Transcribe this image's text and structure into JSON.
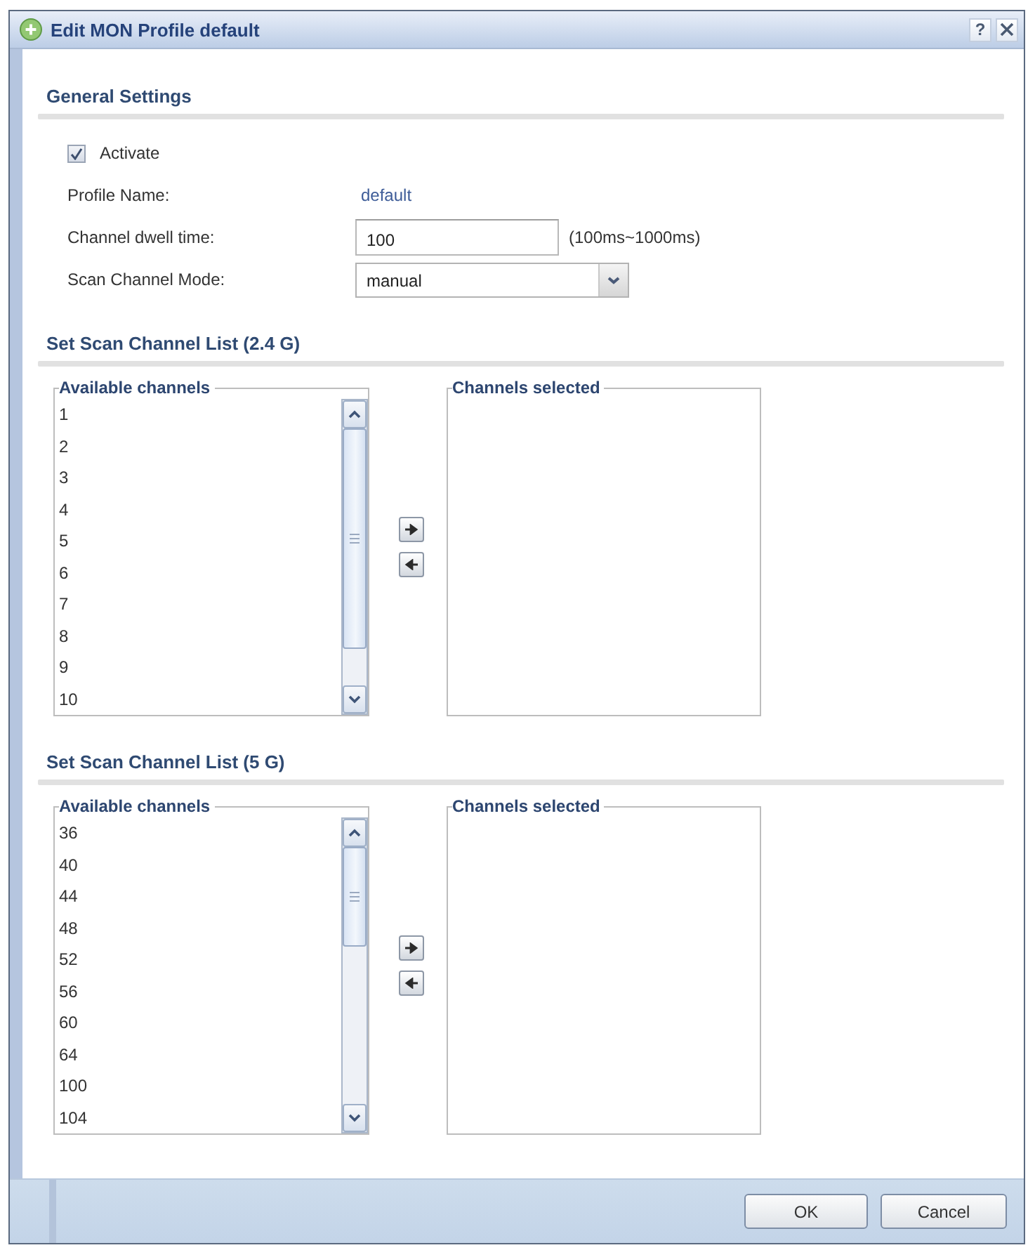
{
  "window": {
    "title": "Edit MON Profile default",
    "help_label": "?"
  },
  "general_settings": {
    "title": "General Settings",
    "activate": {
      "label": "Activate",
      "checked": true
    },
    "profile_name": {
      "label": "Profile Name:",
      "value": "default"
    },
    "channel_dwell_time": {
      "label": "Channel dwell time:",
      "value": "100",
      "range_hint": "(100ms~1000ms)"
    },
    "scan_channel_mode": {
      "label": "Scan Channel Mode:",
      "value": "manual"
    }
  },
  "channel_lists": [
    {
      "title": "Set Scan Channel List (2.4 G)",
      "available": {
        "legend": "Available channels",
        "channels": [
          "1",
          "2",
          "3",
          "4",
          "5",
          "6",
          "7",
          "8",
          "9",
          "10"
        ]
      },
      "selected": {
        "legend": "Channels selected"
      }
    },
    {
      "title": "Set Scan Channel List (5 G)",
      "available": {
        "legend": "Available channels",
        "channels": [
          "36",
          "40",
          "44",
          "48",
          "52",
          "56",
          "60",
          "64",
          "100",
          "104"
        ]
      },
      "selected": {
        "legend": "Channels selected"
      }
    }
  ],
  "buttons": [
    "OK",
    "Cancel"
  ]
}
